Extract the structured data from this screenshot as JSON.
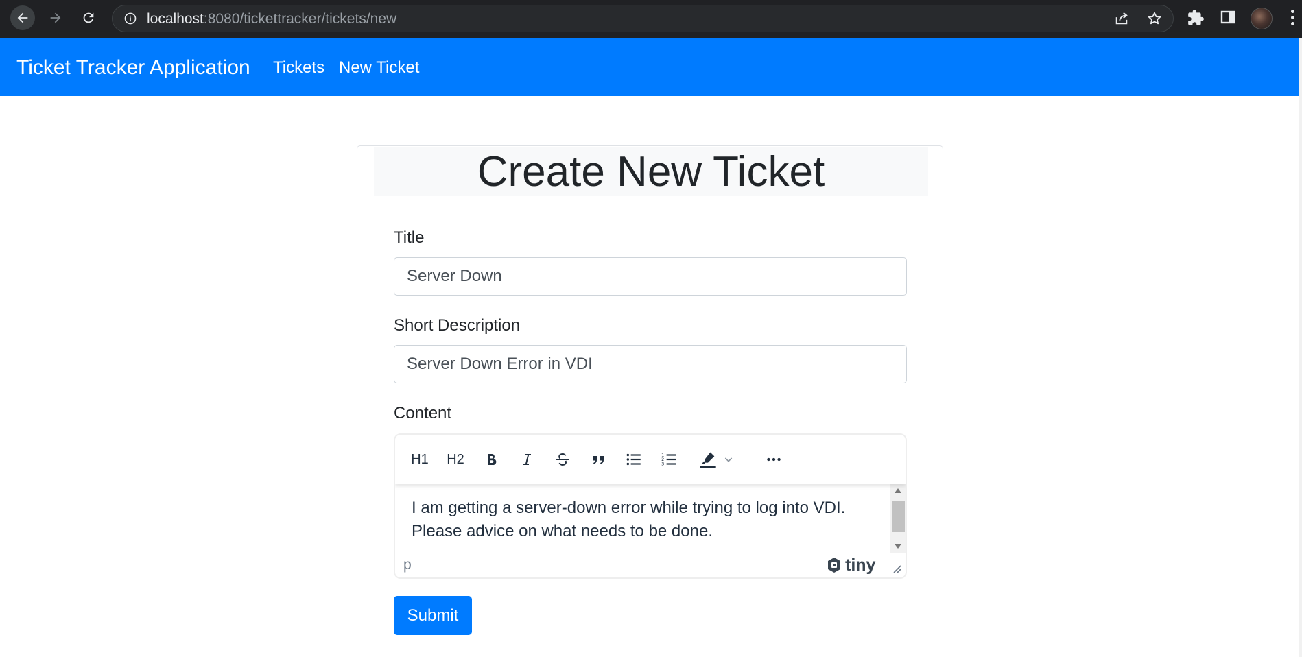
{
  "browser": {
    "url_host": "localhost",
    "url_rest": ":8080/tickettracker/tickets/new"
  },
  "navbar": {
    "brand": "Ticket Tracker Application",
    "links": [
      {
        "label": "Tickets"
      },
      {
        "label": "New Ticket"
      }
    ],
    "color": "#007bff"
  },
  "form": {
    "heading": "Create New Ticket",
    "title_label": "Title",
    "title_value": "Server Down",
    "short_description_label": "Short Description",
    "short_description_value": "Server Down Error in VDI",
    "content_label": "Content",
    "editor": {
      "toolbar": {
        "h1": "H1",
        "h2": "H2"
      },
      "content_text": "I am getting a server-down error while trying to log into VDI. Please advice on what needs to be done.",
      "status_path": "p",
      "brand": "tiny"
    },
    "submit_label": "Submit"
  }
}
